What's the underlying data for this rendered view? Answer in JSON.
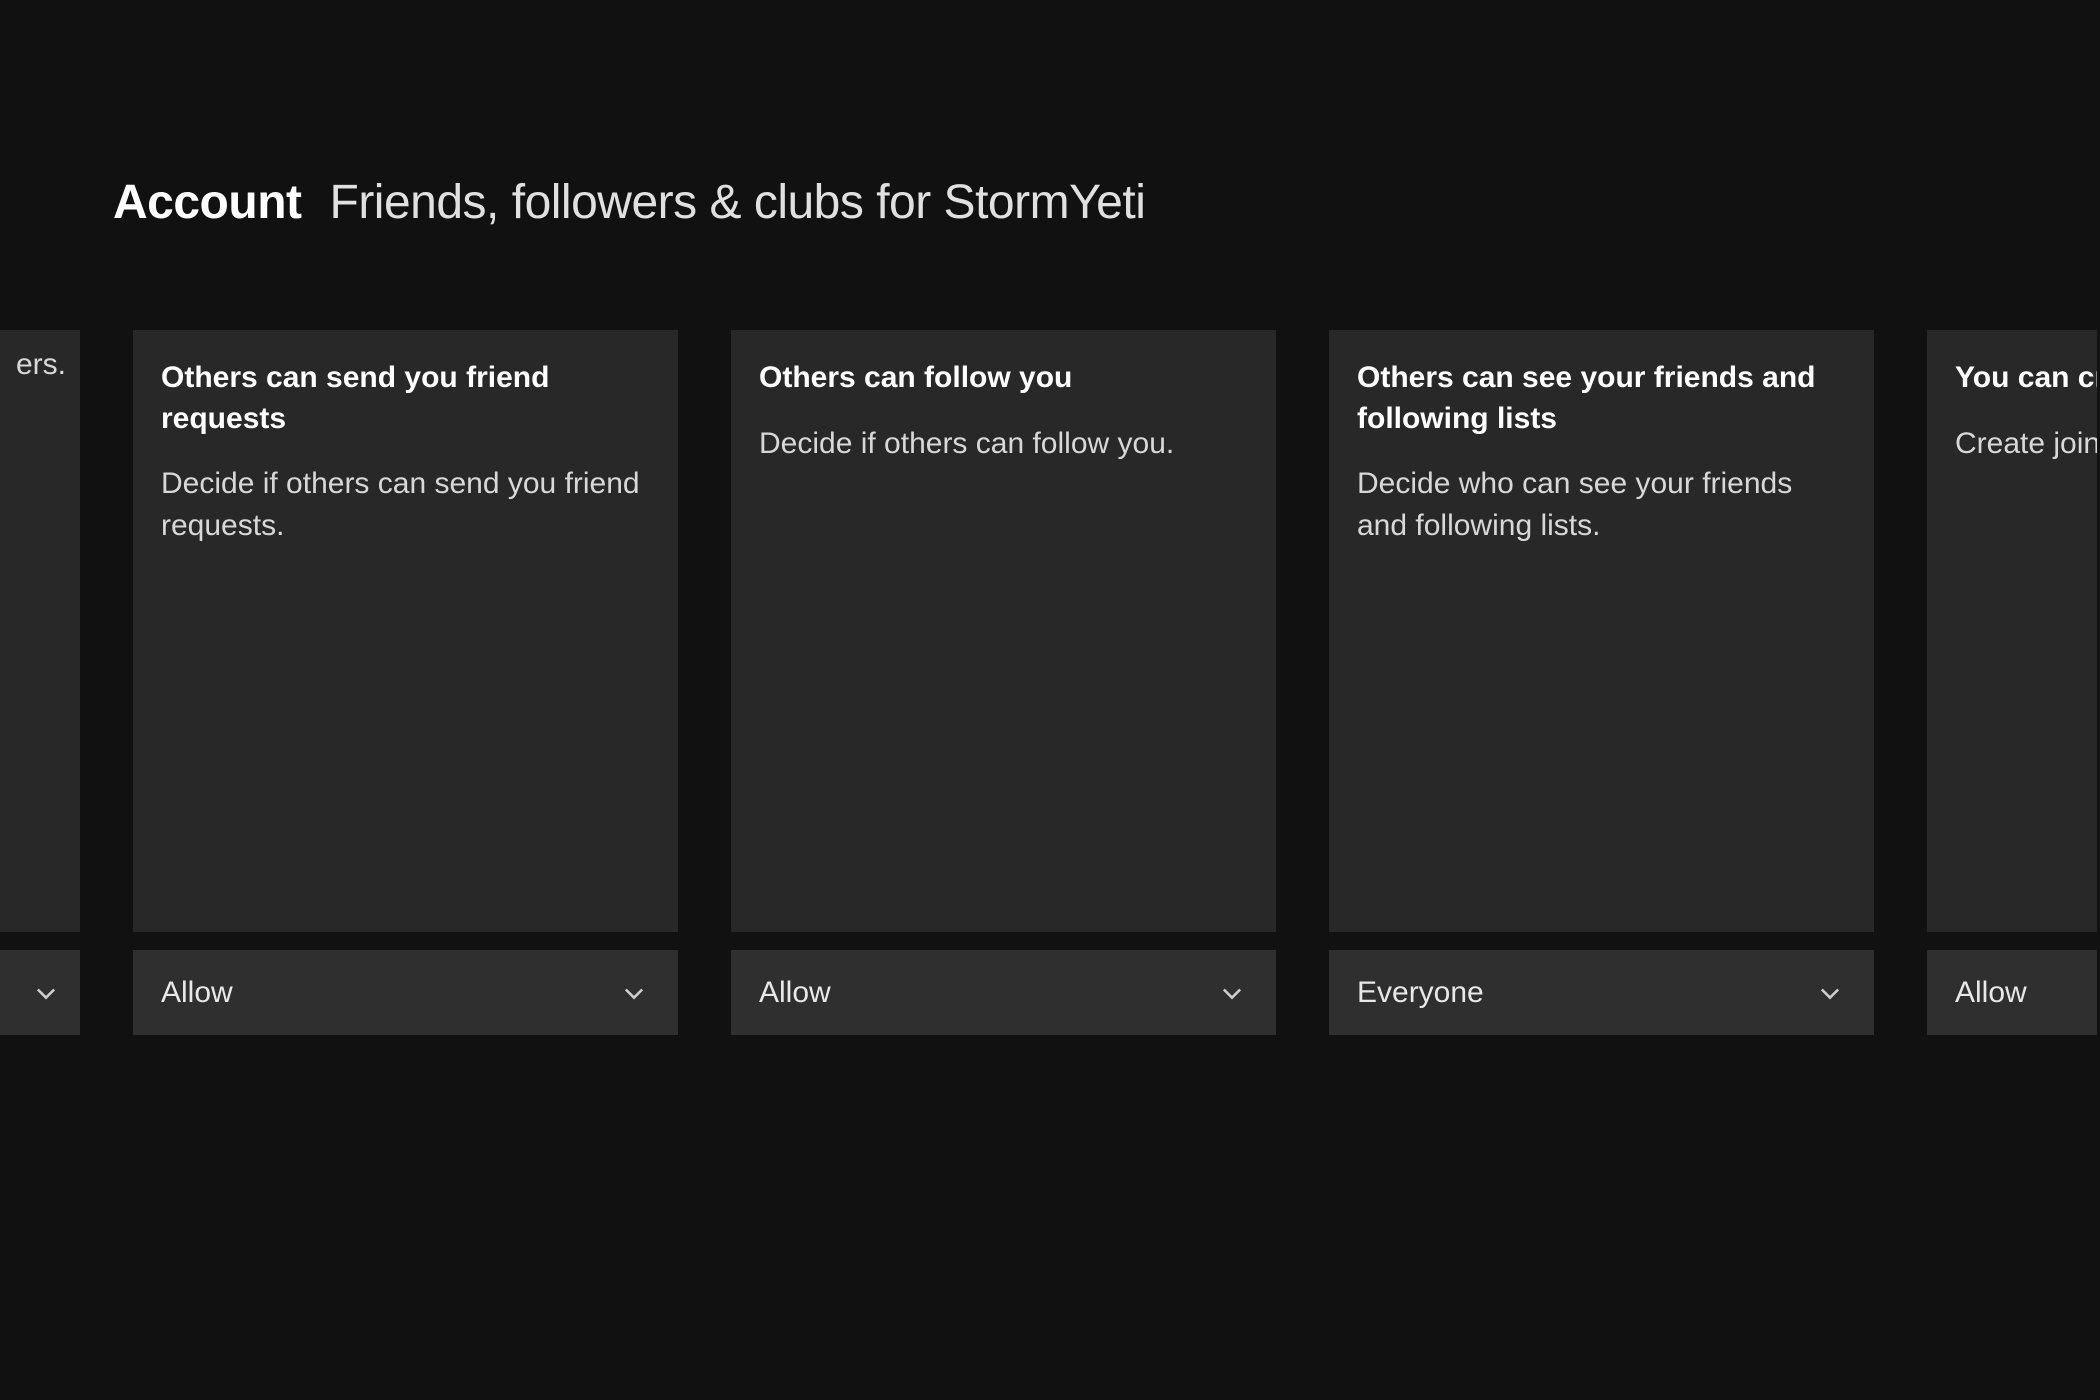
{
  "header": {
    "section": "Account",
    "title": "Friends, followers & clubs for StormYeti"
  },
  "cards": {
    "partial_left": {
      "desc_fragment": "ers.",
      "select_value": ""
    },
    "c1": {
      "title": "Others can send you friend requests",
      "desc": "Decide if others can send you friend requests.",
      "select_value": "Allow"
    },
    "c2": {
      "title": "Others can follow you",
      "desc": "Decide if others can follow you.",
      "select_value": "Allow"
    },
    "c3": {
      "title": "Others can see your friends and following lists",
      "desc": "Decide who can see your friends and following lists.",
      "select_value": "Everyone"
    },
    "partial_right": {
      "title_fragment": "You can cre",
      "desc_fragment": "Create join,",
      "select_value": "Allow"
    }
  }
}
